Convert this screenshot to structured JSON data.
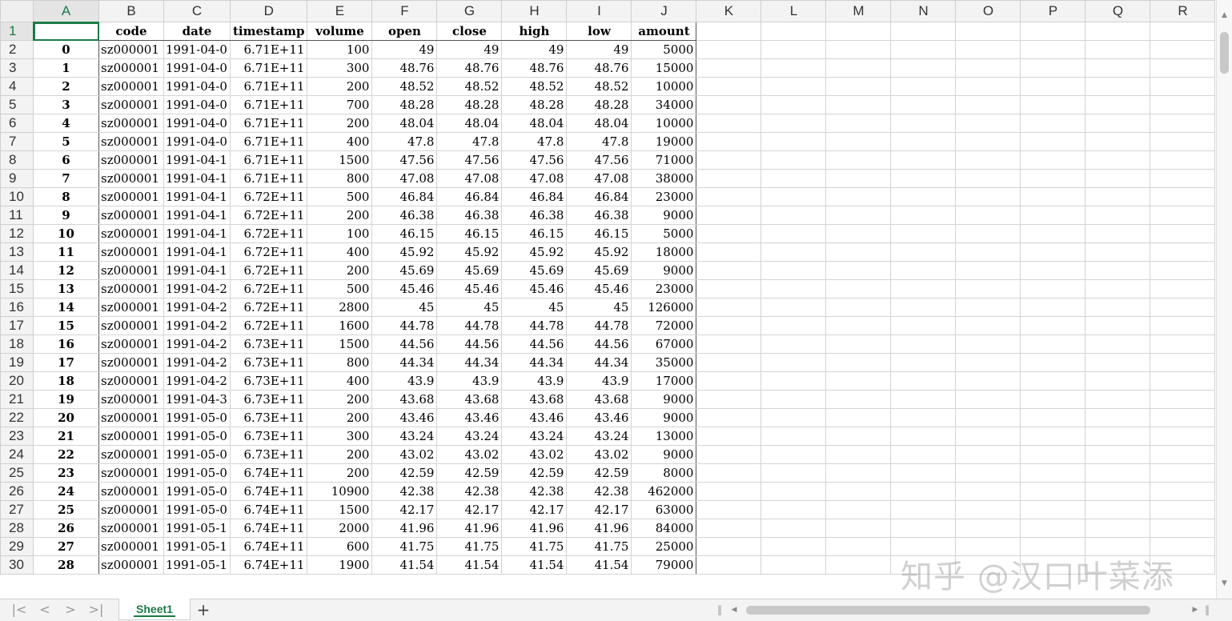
{
  "columns": [
    "A",
    "B",
    "C",
    "D",
    "E",
    "F",
    "G",
    "H",
    "I",
    "J",
    "K",
    "L",
    "M",
    "N",
    "O",
    "P",
    "Q",
    "R"
  ],
  "header_row": [
    "",
    "code",
    "date",
    "timestamp",
    "volume",
    "open",
    "close",
    "high",
    "low",
    "amount"
  ],
  "rows": [
    [
      "0",
      "sz000001",
      "1991-04-0",
      "6.71E+11",
      "100",
      "49",
      "49",
      "49",
      "49",
      "5000"
    ],
    [
      "1",
      "sz000001",
      "1991-04-0",
      "6.71E+11",
      "300",
      "48.76",
      "48.76",
      "48.76",
      "48.76",
      "15000"
    ],
    [
      "2",
      "sz000001",
      "1991-04-0",
      "6.71E+11",
      "200",
      "48.52",
      "48.52",
      "48.52",
      "48.52",
      "10000"
    ],
    [
      "3",
      "sz000001",
      "1991-04-0",
      "6.71E+11",
      "700",
      "48.28",
      "48.28",
      "48.28",
      "48.28",
      "34000"
    ],
    [
      "4",
      "sz000001",
      "1991-04-0",
      "6.71E+11",
      "200",
      "48.04",
      "48.04",
      "48.04",
      "48.04",
      "10000"
    ],
    [
      "5",
      "sz000001",
      "1991-04-0",
      "6.71E+11",
      "400",
      "47.8",
      "47.8",
      "47.8",
      "47.8",
      "19000"
    ],
    [
      "6",
      "sz000001",
      "1991-04-1",
      "6.71E+11",
      "1500",
      "47.56",
      "47.56",
      "47.56",
      "47.56",
      "71000"
    ],
    [
      "7",
      "sz000001",
      "1991-04-1",
      "6.71E+11",
      "800",
      "47.08",
      "47.08",
      "47.08",
      "47.08",
      "38000"
    ],
    [
      "8",
      "sz000001",
      "1991-04-1",
      "6.72E+11",
      "500",
      "46.84",
      "46.84",
      "46.84",
      "46.84",
      "23000"
    ],
    [
      "9",
      "sz000001",
      "1991-04-1",
      "6.72E+11",
      "200",
      "46.38",
      "46.38",
      "46.38",
      "46.38",
      "9000"
    ],
    [
      "10",
      "sz000001",
      "1991-04-1",
      "6.72E+11",
      "100",
      "46.15",
      "46.15",
      "46.15",
      "46.15",
      "5000"
    ],
    [
      "11",
      "sz000001",
      "1991-04-1",
      "6.72E+11",
      "400",
      "45.92",
      "45.92",
      "45.92",
      "45.92",
      "18000"
    ],
    [
      "12",
      "sz000001",
      "1991-04-1",
      "6.72E+11",
      "200",
      "45.69",
      "45.69",
      "45.69",
      "45.69",
      "9000"
    ],
    [
      "13",
      "sz000001",
      "1991-04-2",
      "6.72E+11",
      "500",
      "45.46",
      "45.46",
      "45.46",
      "45.46",
      "23000"
    ],
    [
      "14",
      "sz000001",
      "1991-04-2",
      "6.72E+11",
      "2800",
      "45",
      "45",
      "45",
      "45",
      "126000"
    ],
    [
      "15",
      "sz000001",
      "1991-04-2",
      "6.72E+11",
      "1600",
      "44.78",
      "44.78",
      "44.78",
      "44.78",
      "72000"
    ],
    [
      "16",
      "sz000001",
      "1991-04-2",
      "6.73E+11",
      "1500",
      "44.56",
      "44.56",
      "44.56",
      "44.56",
      "67000"
    ],
    [
      "17",
      "sz000001",
      "1991-04-2",
      "6.73E+11",
      "800",
      "44.34",
      "44.34",
      "44.34",
      "44.34",
      "35000"
    ],
    [
      "18",
      "sz000001",
      "1991-04-2",
      "6.73E+11",
      "400",
      "43.9",
      "43.9",
      "43.9",
      "43.9",
      "17000"
    ],
    [
      "19",
      "sz000001",
      "1991-04-3",
      "6.73E+11",
      "200",
      "43.68",
      "43.68",
      "43.68",
      "43.68",
      "9000"
    ],
    [
      "20",
      "sz000001",
      "1991-05-0",
      "6.73E+11",
      "200",
      "43.46",
      "43.46",
      "43.46",
      "43.46",
      "9000"
    ],
    [
      "21",
      "sz000001",
      "1991-05-0",
      "6.73E+11",
      "300",
      "43.24",
      "43.24",
      "43.24",
      "43.24",
      "13000"
    ],
    [
      "22",
      "sz000001",
      "1991-05-0",
      "6.73E+11",
      "200",
      "43.02",
      "43.02",
      "43.02",
      "43.02",
      "9000"
    ],
    [
      "23",
      "sz000001",
      "1991-05-0",
      "6.74E+11",
      "200",
      "42.59",
      "42.59",
      "42.59",
      "42.59",
      "8000"
    ],
    [
      "24",
      "sz000001",
      "1991-05-0",
      "6.74E+11",
      "10900",
      "42.38",
      "42.38",
      "42.38",
      "42.38",
      "462000"
    ],
    [
      "25",
      "sz000001",
      "1991-05-0",
      "6.74E+11",
      "1500",
      "42.17",
      "42.17",
      "42.17",
      "42.17",
      "63000"
    ],
    [
      "26",
      "sz000001",
      "1991-05-1",
      "6.74E+11",
      "2000",
      "41.96",
      "41.96",
      "41.96",
      "41.96",
      "84000"
    ],
    [
      "27",
      "sz000001",
      "1991-05-1",
      "6.74E+11",
      "600",
      "41.75",
      "41.75",
      "41.75",
      "41.75",
      "25000"
    ],
    [
      "28",
      "sz000001",
      "1991-05-1",
      "6.74E+11",
      "1900",
      "41.54",
      "41.54",
      "41.54",
      "41.54",
      "79000"
    ]
  ],
  "active_cell": {
    "column": "A",
    "row": 1
  },
  "sheet_tabs": [
    {
      "label": "Sheet1",
      "active": true
    }
  ],
  "add_sheet_label": "+",
  "nav": {
    "first": "|<",
    "prev": "<",
    "next": ">",
    "last": ">|"
  },
  "watermark": "知乎 @汉口叶菜添",
  "colors": {
    "accent": "#1d7a46",
    "header_bg": "#f3f3f3",
    "gridline": "#d4d4d4"
  },
  "icons": [
    "first-sheet-icon",
    "prev-sheet-icon",
    "next-sheet-icon",
    "last-sheet-icon",
    "add-sheet-icon",
    "scroll-up-icon",
    "scroll-down-icon",
    "scroll-left-icon",
    "scroll-right-icon"
  ]
}
